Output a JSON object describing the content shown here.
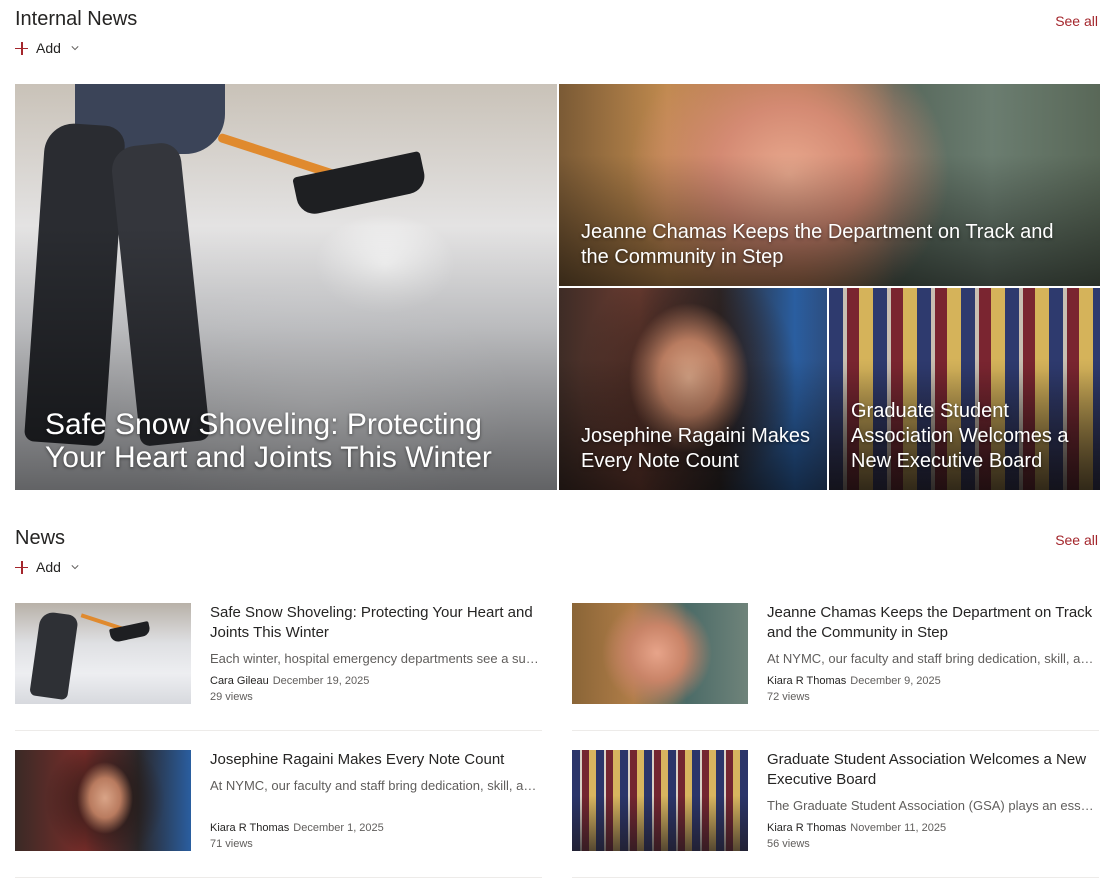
{
  "internal_news": {
    "title": "Internal News",
    "see_all": "See all",
    "add_label": "Add",
    "tiles": [
      {
        "title": "Safe Snow Shoveling: Protecting Your Heart and Joints This Winter",
        "image": "snow-shoveling-photo"
      },
      {
        "title": "Jeanne Chamas Keeps the Department on Track and the Community in Step",
        "image": "portrait-photo"
      },
      {
        "title": "Josephine Ragaini Makes Every Note Count",
        "image": "portrait-photo"
      },
      {
        "title": "Graduate Student Association Welcomes a New Executive Board",
        "image": "group-photo"
      }
    ]
  },
  "news": {
    "title": "News",
    "see_all": "See all",
    "add_label": "Add",
    "items": [
      {
        "title": "Safe Snow Shoveling: Protecting Your Heart and Joints This Winter",
        "description": "Each winter, hospital emergency departments see a surge in cardiac events related to snow shoveling.",
        "author": "Cara Gileau",
        "date": "December 19, 2025",
        "views": "29 views"
      },
      {
        "title": "Jeanne Chamas Keeps the Department on Track and the Community in Step",
        "description": "At NYMC, our faculty and staff bring dedication, skill, and heart to everything they do.",
        "author": "Kiara R Thomas",
        "date": "December 9, 2025",
        "views": "72 views"
      },
      {
        "title": "Josephine Ragaini Makes Every Note Count",
        "description": "At NYMC, our faculty and staff bring dedication, skill, and heart to everything they do.",
        "author": "Kiara R Thomas",
        "date": "December 1, 2025",
        "views": "71 views"
      },
      {
        "title": "Graduate Student Association Welcomes a New Executive Board",
        "description": "The Graduate Student Association (GSA) plays an essential role in student life.",
        "author": "Kiara R Thomas",
        "date": "November 11, 2025",
        "views": "56 views"
      }
    ]
  },
  "colors": {
    "accent": "#a4262c",
    "text": "#252423",
    "secondary": "#605e5c"
  }
}
